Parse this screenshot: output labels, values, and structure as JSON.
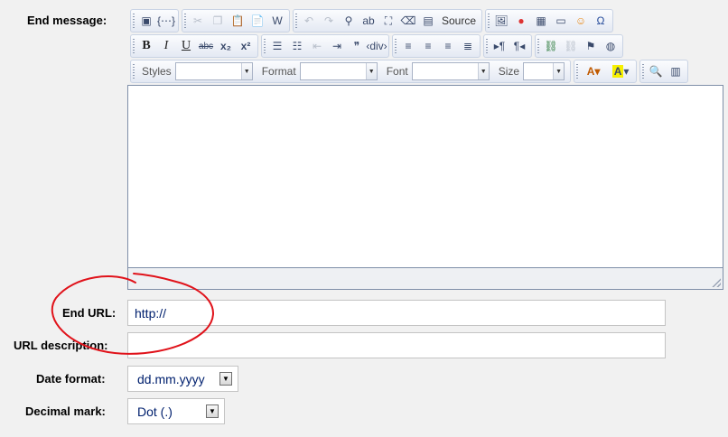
{
  "labels": {
    "end_message": "End message:",
    "end_url": "End URL:",
    "url_description": "URL description:",
    "date_format": "Date format:",
    "decimal_mark": "Decimal mark:"
  },
  "toolbar": {
    "source_label": "Source",
    "styles_label": "Styles",
    "format_label": "Format",
    "font_label": "Font",
    "size_label": "Size",
    "subscript": "x₂",
    "superscript": "x²",
    "bold": "B",
    "italic": "I",
    "underline": "U",
    "strike": "abc"
  },
  "fields": {
    "end_url_value": "http://",
    "url_description_value": "",
    "date_format_value": "dd.mm.yyyy",
    "decimal_mark_value": "Dot (.)"
  },
  "colors": {
    "annotation": "#e0121a",
    "page_bg": "#f1f1f1",
    "value_text": "#00206e"
  }
}
